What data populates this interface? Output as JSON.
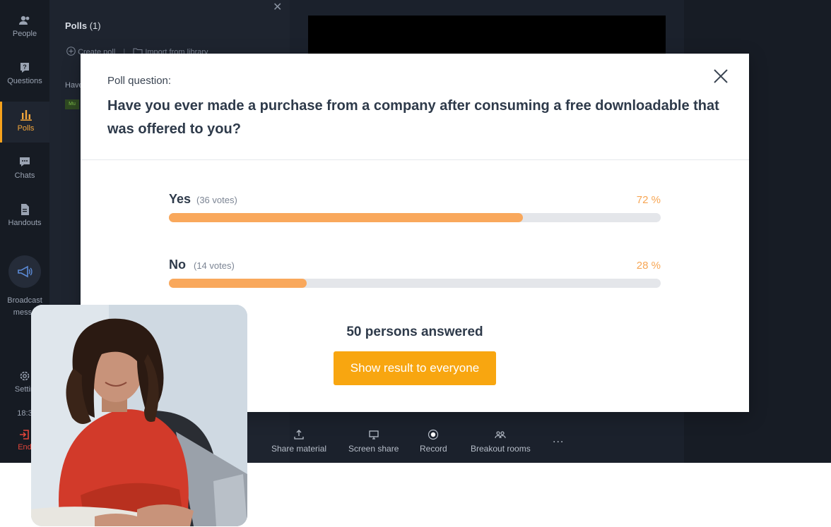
{
  "nav": {
    "items": [
      {
        "label": "People",
        "icon": "people-icon"
      },
      {
        "label": "Questions",
        "icon": "question-icon"
      },
      {
        "label": "Polls",
        "icon": "polls-icon",
        "active": true
      },
      {
        "label": "Chats",
        "icon": "chat-icon"
      },
      {
        "label": "Handouts",
        "icon": "handout-icon"
      }
    ],
    "broadcast_label_1": "Broadcast",
    "broadcast_label_2": "messa",
    "settings_label": "Settin",
    "time": "18:3",
    "end_label": "End"
  },
  "polls_panel": {
    "title": "Polls",
    "count": "(1)",
    "create_poll": "Create poll",
    "import_library": "Import from library",
    "item_text": "Have",
    "item_tag": "Mu"
  },
  "toolbar": {
    "share_material": "Share material",
    "screen_share": "Screen share",
    "record": "Record",
    "breakout_rooms": "Breakout rooms",
    "more": "..."
  },
  "modal": {
    "question_label": "Poll question:",
    "question": "Have you ever made a purchase from a company after consuming a free downloadable that was offered to you?",
    "options": [
      {
        "label": "Yes",
        "votes": "(36 votes)",
        "percent_text": "72 %",
        "fraction": 0.72
      },
      {
        "label": "No",
        "votes": "(14 votes)",
        "percent_text": "28 %",
        "fraction": 0.28
      }
    ],
    "answered": "50 persons answered",
    "show_result_button": "Show result to everyone"
  },
  "colors": {
    "accent": "#f8a610",
    "bar_fill": "#f9a85c",
    "bar_track": "#e4e6ea",
    "app_bg": "#1b212c"
  }
}
